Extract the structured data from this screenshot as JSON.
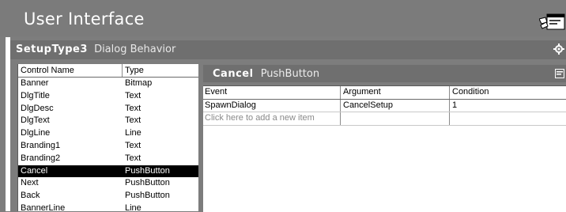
{
  "header": {
    "title": "User Interface",
    "icon": "dialog-editor-icon"
  },
  "section": {
    "name": "SetupType3",
    "subtitle": "Dialog Behavior",
    "icon": "settings-gear-icon"
  },
  "controls": {
    "columns": [
      "Control Name",
      "Type"
    ],
    "rows": [
      {
        "name": "Banner",
        "type": "Bitmap"
      },
      {
        "name": "DlgTitle",
        "type": "Text"
      },
      {
        "name": "DlgDesc",
        "type": "Text"
      },
      {
        "name": "DlgText",
        "type": "Text"
      },
      {
        "name": "DlgLine",
        "type": "Line"
      },
      {
        "name": "Branding1",
        "type": "Text"
      },
      {
        "name": "Branding2",
        "type": "Text"
      },
      {
        "name": "Cancel",
        "type": "PushButton"
      },
      {
        "name": "Next",
        "type": "PushButton"
      },
      {
        "name": "Back",
        "type": "PushButton"
      },
      {
        "name": "BannerLine",
        "type": "Line"
      }
    ],
    "selected_name": "Cancel"
  },
  "detail": {
    "control_name": "Cancel",
    "control_type": "PushButton",
    "icon": "properties-icon"
  },
  "events": {
    "columns": [
      "Event",
      "Argument",
      "Condition"
    ],
    "rows": [
      {
        "event": "SpawnDialog",
        "argument": "CancelSetup",
        "condition": "1"
      }
    ],
    "add_placeholder": "Click here to add a new item"
  }
}
